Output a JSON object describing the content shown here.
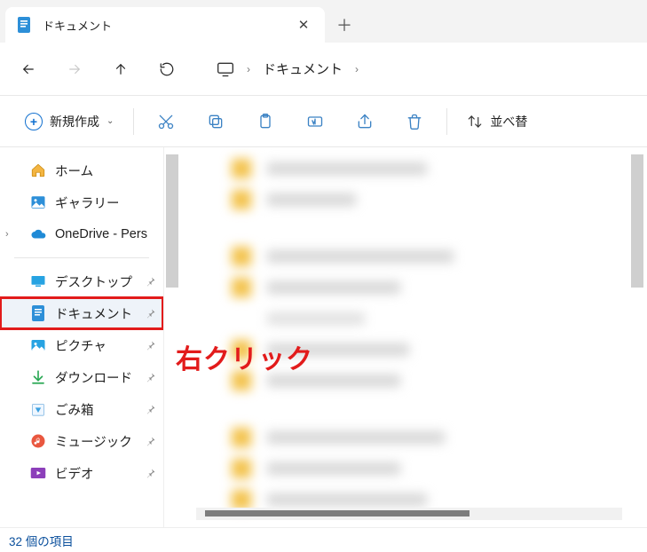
{
  "tab": {
    "title": "ドキュメント"
  },
  "address": {
    "root_icon": "monitor-icon",
    "segments": [
      "ドキュメント"
    ]
  },
  "toolbar": {
    "new_label": "新規作成",
    "sort_label": "並べ替"
  },
  "sidebar": {
    "group1": [
      {
        "key": "home",
        "label": "ホーム"
      },
      {
        "key": "gallery",
        "label": "ギャラリー"
      },
      {
        "key": "onedrive",
        "label": "OneDrive - Pers",
        "expandable": true
      }
    ],
    "group2": [
      {
        "key": "desktop",
        "label": "デスクトップ",
        "pinned": true
      },
      {
        "key": "documents",
        "label": "ドキュメント",
        "pinned": true,
        "selected": true,
        "highlight": true
      },
      {
        "key": "pictures",
        "label": "ピクチャ",
        "pinned": true
      },
      {
        "key": "downloads",
        "label": "ダウンロード",
        "pinned": true
      },
      {
        "key": "recycle",
        "label": "ごみ箱",
        "pinned": true
      },
      {
        "key": "music",
        "label": "ミュージック",
        "pinned": true
      },
      {
        "key": "videos",
        "label": "ビデオ",
        "pinned": true
      }
    ]
  },
  "annotation": "右クリック",
  "status": {
    "text": "32 個の項目"
  },
  "icons": {
    "close_glyph": "✕",
    "plus_glyph": "＋",
    "pin_glyph": "📌",
    "chev_right": "›",
    "chev_down": "⌄",
    "back_glyph": "←",
    "fwd_glyph": "→",
    "up_glyph": "↑",
    "reload_glyph": "↻",
    "sort_glyph": "↑↓"
  }
}
